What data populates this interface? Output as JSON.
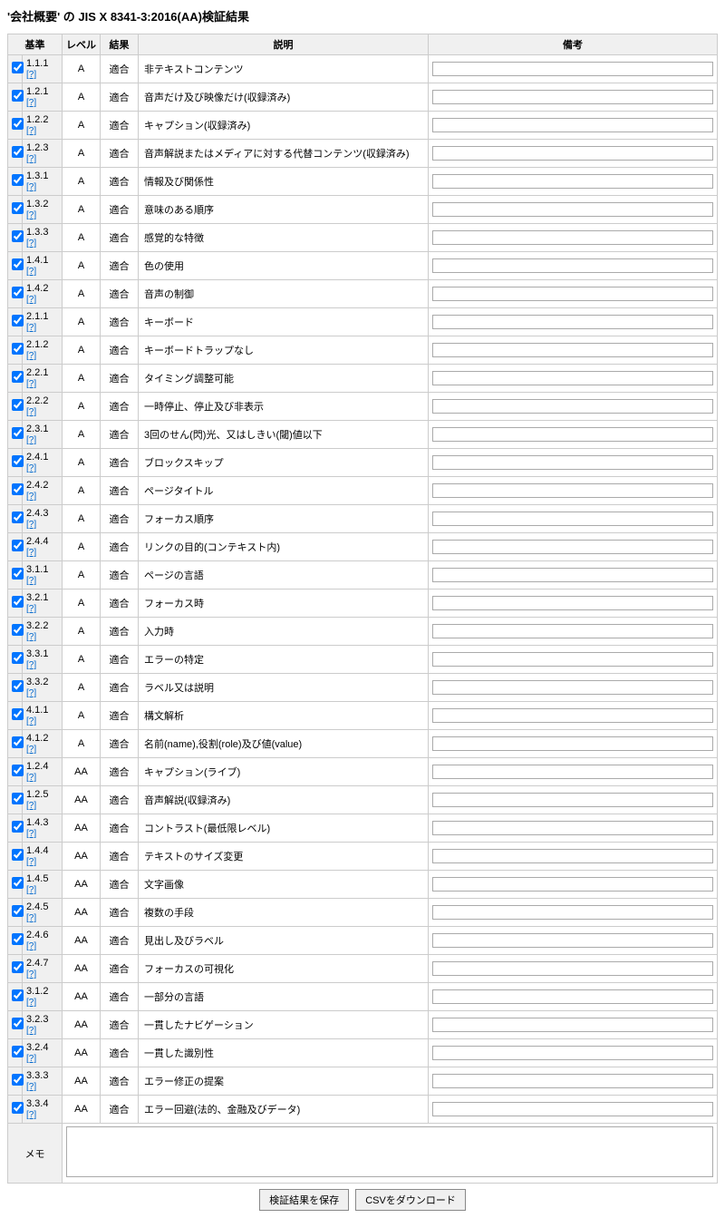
{
  "title": "'会社概要' の JIS X 8341-3:2016(AA)検証結果",
  "headers": {
    "criterion": "基準",
    "level": "レベル",
    "result": "結果",
    "description": "説明",
    "note": "備考"
  },
  "help_label": "[?]",
  "memo_label": "メモ",
  "memo_value": "",
  "buttons": {
    "save": "検証結果を保存",
    "csv": "CSVをダウンロード"
  },
  "rows": [
    {
      "crit": "1.1.1",
      "lvl": "A",
      "res": "適合",
      "desc": "非テキストコンテンツ",
      "note": ""
    },
    {
      "crit": "1.2.1",
      "lvl": "A",
      "res": "適合",
      "desc": "音声だけ及び映像だけ(収録済み)",
      "note": ""
    },
    {
      "crit": "1.2.2",
      "lvl": "A",
      "res": "適合",
      "desc": "キャプション(収録済み)",
      "note": ""
    },
    {
      "crit": "1.2.3",
      "lvl": "A",
      "res": "適合",
      "desc": "音声解説またはメディアに対する代替コンテンツ(収録済み)",
      "note": ""
    },
    {
      "crit": "1.3.1",
      "lvl": "A",
      "res": "適合",
      "desc": "情報及び関係性",
      "note": ""
    },
    {
      "crit": "1.3.2",
      "lvl": "A",
      "res": "適合",
      "desc": "意味のある順序",
      "note": ""
    },
    {
      "crit": "1.3.3",
      "lvl": "A",
      "res": "適合",
      "desc": "感覚的な特徴",
      "note": ""
    },
    {
      "crit": "1.4.1",
      "lvl": "A",
      "res": "適合",
      "desc": "色の使用",
      "note": ""
    },
    {
      "crit": "1.4.2",
      "lvl": "A",
      "res": "適合",
      "desc": "音声の制御",
      "note": ""
    },
    {
      "crit": "2.1.1",
      "lvl": "A",
      "res": "適合",
      "desc": "キーボード",
      "note": ""
    },
    {
      "crit": "2.1.2",
      "lvl": "A",
      "res": "適合",
      "desc": "キーボードトラップなし",
      "note": ""
    },
    {
      "crit": "2.2.1",
      "lvl": "A",
      "res": "適合",
      "desc": "タイミング調整可能",
      "note": ""
    },
    {
      "crit": "2.2.2",
      "lvl": "A",
      "res": "適合",
      "desc": "一時停止、停止及び非表示",
      "note": ""
    },
    {
      "crit": "2.3.1",
      "lvl": "A",
      "res": "適合",
      "desc": "3回のせん(閃)光、又はしきい(閾)値以下",
      "note": ""
    },
    {
      "crit": "2.4.1",
      "lvl": "A",
      "res": "適合",
      "desc": "ブロックスキップ",
      "note": ""
    },
    {
      "crit": "2.4.2",
      "lvl": "A",
      "res": "適合",
      "desc": "ページタイトル",
      "note": ""
    },
    {
      "crit": "2.4.3",
      "lvl": "A",
      "res": "適合",
      "desc": "フォーカス順序",
      "note": ""
    },
    {
      "crit": "2.4.4",
      "lvl": "A",
      "res": "適合",
      "desc": "リンクの目的(コンテキスト内)",
      "note": ""
    },
    {
      "crit": "3.1.1",
      "lvl": "A",
      "res": "適合",
      "desc": "ページの言語",
      "note": ""
    },
    {
      "crit": "3.2.1",
      "lvl": "A",
      "res": "適合",
      "desc": "フォーカス時",
      "note": ""
    },
    {
      "crit": "3.2.2",
      "lvl": "A",
      "res": "適合",
      "desc": "入力時",
      "note": ""
    },
    {
      "crit": "3.3.1",
      "lvl": "A",
      "res": "適合",
      "desc": "エラーの特定",
      "note": ""
    },
    {
      "crit": "3.3.2",
      "lvl": "A",
      "res": "適合",
      "desc": "ラベル又は説明",
      "note": ""
    },
    {
      "crit": "4.1.1",
      "lvl": "A",
      "res": "適合",
      "desc": "構文解析",
      "note": ""
    },
    {
      "crit": "4.1.2",
      "lvl": "A",
      "res": "適合",
      "desc": "名前(name),役割(role)及び値(value)",
      "note": ""
    },
    {
      "crit": "1.2.4",
      "lvl": "AA",
      "res": "適合",
      "desc": "キャプション(ライブ)",
      "note": ""
    },
    {
      "crit": "1.2.5",
      "lvl": "AA",
      "res": "適合",
      "desc": "音声解説(収録済み)",
      "note": ""
    },
    {
      "crit": "1.4.3",
      "lvl": "AA",
      "res": "適合",
      "desc": "コントラスト(最低限レベル)",
      "note": ""
    },
    {
      "crit": "1.4.4",
      "lvl": "AA",
      "res": "適合",
      "desc": "テキストのサイズ変更",
      "note": ""
    },
    {
      "crit": "1.4.5",
      "lvl": "AA",
      "res": "適合",
      "desc": "文字画像",
      "note": ""
    },
    {
      "crit": "2.4.5",
      "lvl": "AA",
      "res": "適合",
      "desc": "複数の手段",
      "note": ""
    },
    {
      "crit": "2.4.6",
      "lvl": "AA",
      "res": "適合",
      "desc": "見出し及びラベル",
      "note": ""
    },
    {
      "crit": "2.4.7",
      "lvl": "AA",
      "res": "適合",
      "desc": "フォーカスの可視化",
      "note": ""
    },
    {
      "crit": "3.1.2",
      "lvl": "AA",
      "res": "適合",
      "desc": "一部分の言語",
      "note": ""
    },
    {
      "crit": "3.2.3",
      "lvl": "AA",
      "res": "適合",
      "desc": "一貫したナビゲーション",
      "note": ""
    },
    {
      "crit": "3.2.4",
      "lvl": "AA",
      "res": "適合",
      "desc": "一貫した識別性",
      "note": ""
    },
    {
      "crit": "3.3.3",
      "lvl": "AA",
      "res": "適合",
      "desc": "エラー修正の提案",
      "note": ""
    },
    {
      "crit": "3.3.4",
      "lvl": "AA",
      "res": "適合",
      "desc": "エラー回避(法的、金融及びデータ)",
      "note": ""
    }
  ]
}
